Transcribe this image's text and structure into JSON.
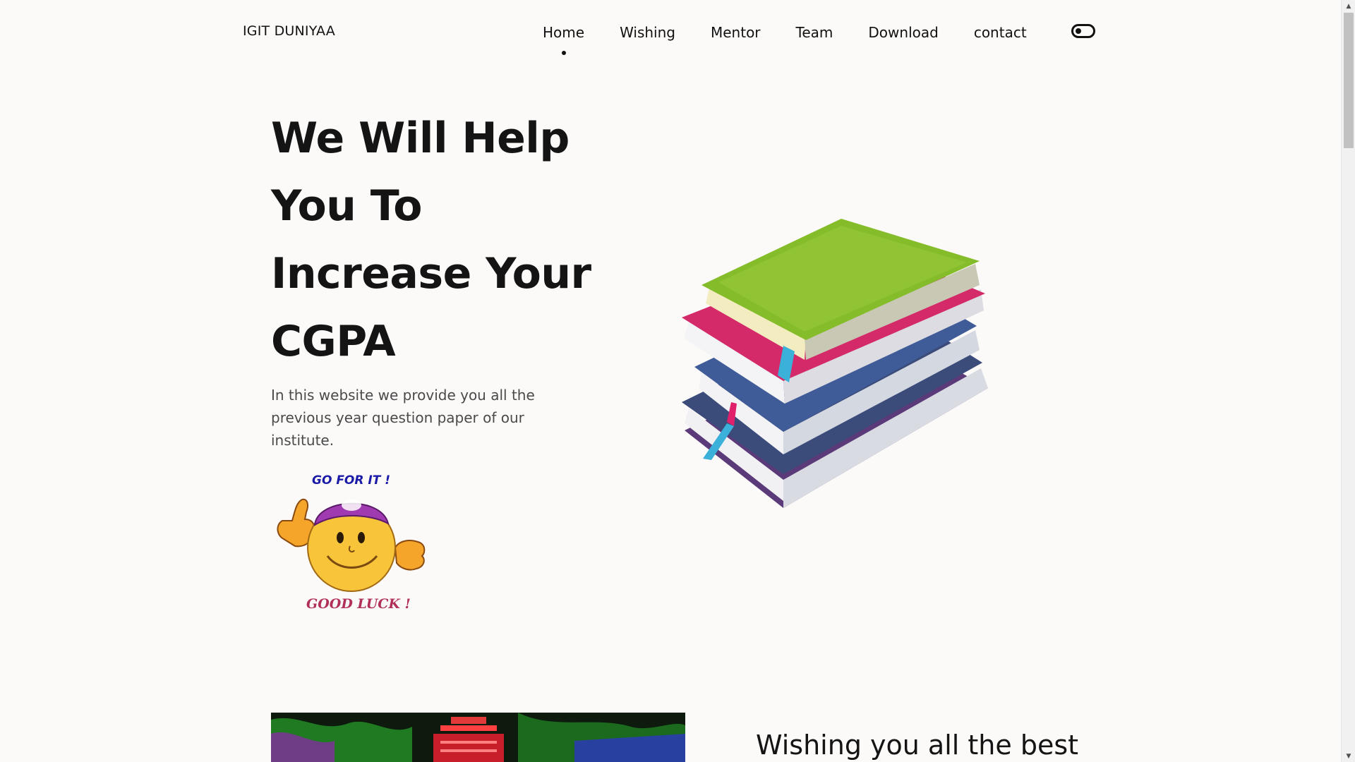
{
  "header": {
    "brand": "IGIT DUNIYAA",
    "nav": [
      {
        "label": "Home",
        "active": true
      },
      {
        "label": "Wishing",
        "active": false
      },
      {
        "label": "Mentor",
        "active": false
      },
      {
        "label": "Team",
        "active": false
      },
      {
        "label": "Download",
        "active": false
      },
      {
        "label": "contact",
        "active": false
      }
    ],
    "theme_toggle_icon": "toggle-icon"
  },
  "hero": {
    "title_lines": [
      "We Will Help",
      "You To",
      "Increase Your",
      "CGPA"
    ],
    "description": "In this website we provide you all the previous year question paper of our institute.",
    "sticker": {
      "top_text": "GO FOR IT !",
      "bottom_text": "GOOD LUCK !"
    }
  },
  "second_section": {
    "title": "Wishing you all the best"
  },
  "colors": {
    "background": "#fcfaf9",
    "text": "#141414",
    "muted_text": "#4a4a4a"
  }
}
